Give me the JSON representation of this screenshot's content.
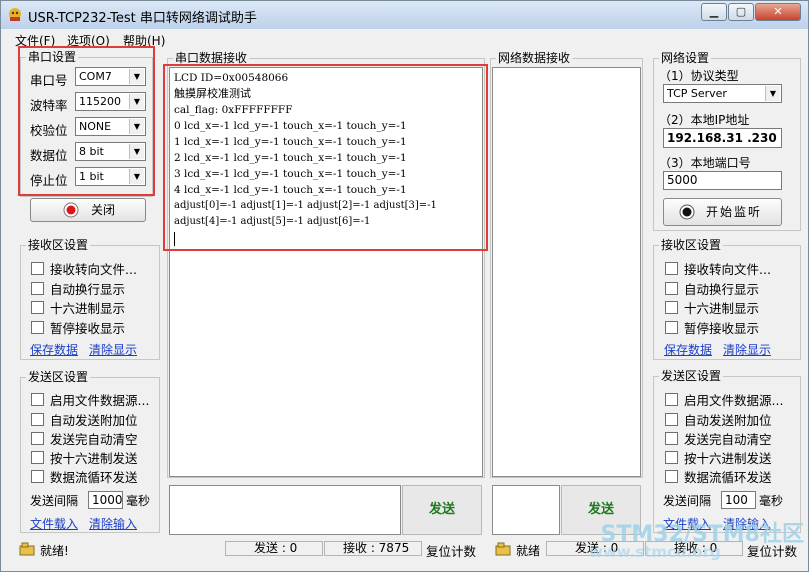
{
  "window": {
    "title": "USR-TCP232-Test 串口转网络调试助手",
    "min_label": "▁",
    "max_label": "▢",
    "close_label": "✕"
  },
  "menu": [
    "文件(F)",
    "选项(O)",
    "帮助(H)"
  ],
  "serial_settings": {
    "title": "串口设置",
    "port_label": "串口号",
    "port_value": "COM7",
    "baud_label": "波特率",
    "baud_value": "115200",
    "parity_label": "校验位",
    "parity_value": "NONE",
    "databits_label": "数据位",
    "databits_value": "8 bit",
    "stopbits_label": "停止位",
    "stopbits_value": "1 bit",
    "close_button": "关闭"
  },
  "left_receive": {
    "title": "接收区设置",
    "options": [
      "接收转向文件...",
      "自动换行显示",
      "十六进制显示",
      "暂停接收显示"
    ],
    "save_link": "保存数据",
    "clear_link": "清除显示"
  },
  "left_send": {
    "title": "发送区设置",
    "options": [
      "启用文件数据源...",
      "自动发送附加位",
      "发送完自动清空",
      "按十六进制发送",
      "数据流循环发送"
    ],
    "interval_label": "发送间隔",
    "interval_value": "1000",
    "interval_unit": "毫秒",
    "load_link": "文件载入",
    "clear_link": "清除输入"
  },
  "serial_receive": {
    "title": "串口数据接收",
    "lines": [
      "LCD ID=0x00548066",
      "触摸屏校准测试",
      "cal_flag: 0xFFFFFFFF",
      "0 lcd_x=-1 lcd_y=-1 touch_x=-1 touch_y=-1",
      "1 lcd_x=-1 lcd_y=-1 touch_x=-1 touch_y=-1",
      "2 lcd_x=-1 lcd_y=-1 touch_x=-1 touch_y=-1",
      "3 lcd_x=-1 lcd_y=-1 touch_x=-1 touch_y=-1",
      "4 lcd_x=-1 lcd_y=-1 touch_x=-1 touch_y=-1",
      "adjust[0]=-1 adjust[1]=-1 adjust[2]=-1 adjust[3]=-1",
      "adjust[4]=-1 adjust[5]=-1 adjust[6]=-1"
    ]
  },
  "network_receive": {
    "title": "网络数据接收"
  },
  "send_button_left": "发送",
  "send_button_right": "发送",
  "network_settings": {
    "title": "网络设置",
    "protocol_label": "（1）协议类型",
    "protocol_value": "TCP Server",
    "ip_label": "（2）本地IP地址",
    "ip_value": "192.168.31 .230",
    "port_label": "（3）本地端口号",
    "port_value": "5000",
    "listen_button": "开始监听"
  },
  "right_receive": {
    "title": "接收区设置",
    "options": [
      "接收转向文件...",
      "自动换行显示",
      "十六进制显示",
      "暂停接收显示"
    ],
    "save_link": "保存数据",
    "clear_link": "清除显示"
  },
  "right_send": {
    "title": "发送区设置",
    "options": [
      "启用文件数据源...",
      "自动发送附加位",
      "发送完自动清空",
      "按十六进制发送",
      "数据流循环发送"
    ],
    "interval_label": "发送间隔",
    "interval_value": "100",
    "interval_unit": "毫秒",
    "load_link": "文件载入",
    "clear_link": "清除输入"
  },
  "status": {
    "ready_left": "就绪!",
    "send_count_left": "发送 : 0",
    "recv_count_left": "接收 : 7875",
    "reset_left": "复位计数",
    "ready_right": "就绪",
    "send_count_right": "发送 : 0",
    "recv_count_right": "接收 : 0",
    "reset_right": "复位计数"
  },
  "watermark": {
    "line1": "STM32/STM8社区",
    "line2": "www.stmcu.org"
  },
  "colors": {
    "highlight_box": "#e03c3c",
    "send_text": "#1f7a1f",
    "link": "#1a3ec9"
  }
}
